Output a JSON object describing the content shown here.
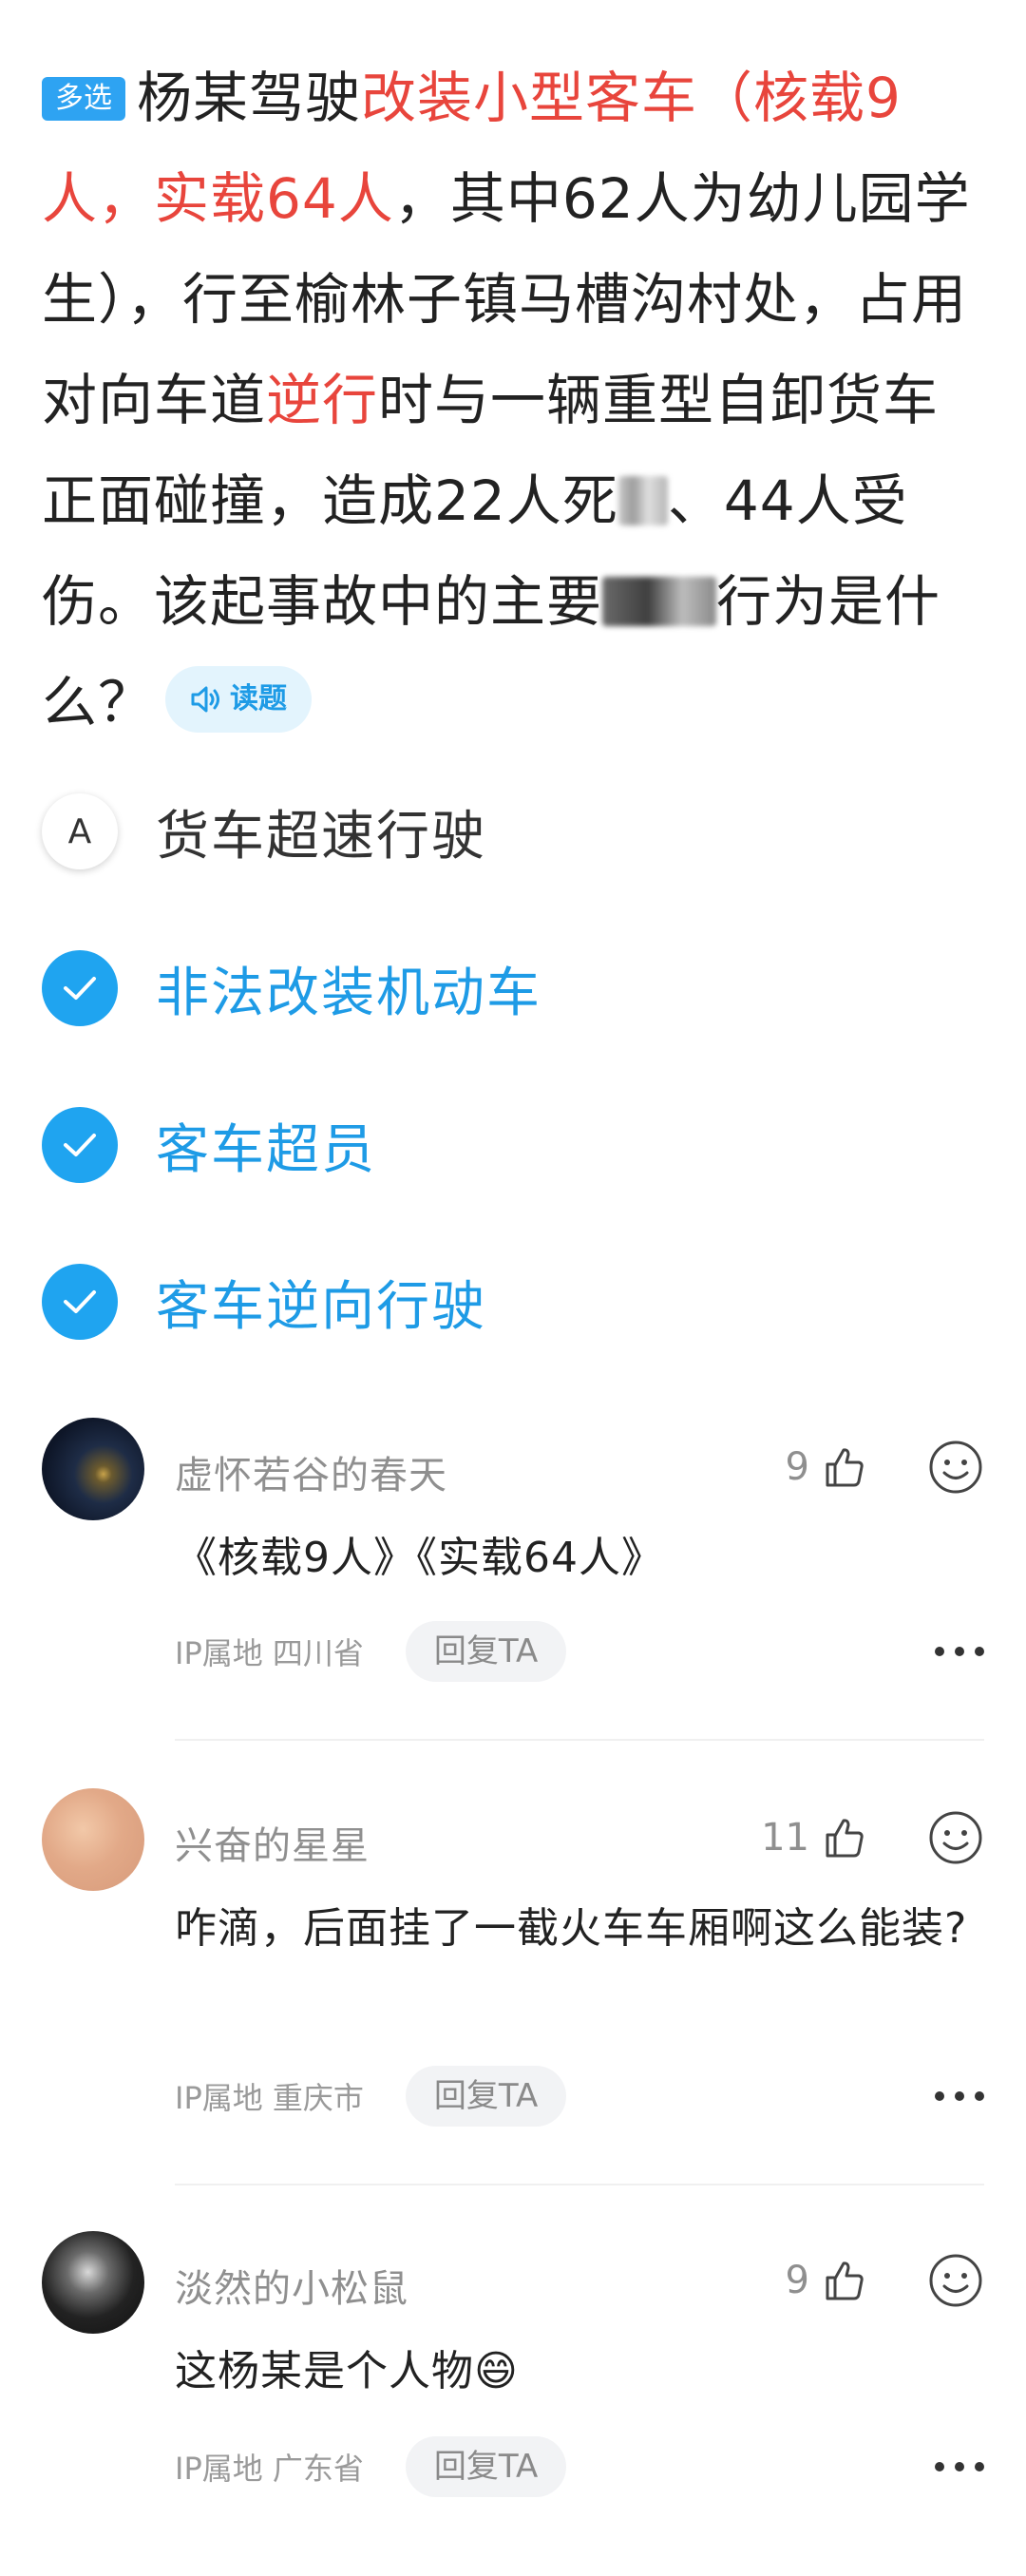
{
  "question": {
    "tag": "多选",
    "parts": {
      "p1": "杨某驾驶",
      "p2": "改装小型客车（核载9人，实载64人",
      "p3": "，其中62人为幼儿园学生），行至榆林子镇马槽沟村处，占用对向车道",
      "p4": "逆行",
      "p5": "时与一辆重型自卸货车正面碰撞，造成22人",
      "p6": "死",
      "p7": "、44人受伤。该起事故中的主要",
      "p8": "行为是什么？"
    },
    "read_label": "读题",
    "highlight_color": "#e8453c"
  },
  "options": [
    {
      "marker": "A",
      "label": "货车超速行驶",
      "selected": false
    },
    {
      "marker": "check",
      "label": "非法改装机动车",
      "selected": true
    },
    {
      "marker": "check",
      "label": "客车超员",
      "selected": true
    },
    {
      "marker": "check",
      "label": "客车逆向行驶",
      "selected": true
    }
  ],
  "accent_color": "#1e9be6",
  "comments": [
    {
      "name": "虚怀若谷的春天",
      "likes": "9",
      "text": "《核载9人》《实载64人》",
      "ip": "IP属地 四川省",
      "reply": "回复TA"
    },
    {
      "name": "兴奋的星星",
      "likes": "11",
      "text": "咋滴，后面挂了一截火车车厢啊这么能装?",
      "ip": "IP属地 重庆市",
      "reply": "回复TA"
    },
    {
      "name": "淡然的小松鼠",
      "likes": "9",
      "text": "这杨某是个人物😄",
      "ip": "IP属地 广东省",
      "reply": "回复TA"
    }
  ]
}
